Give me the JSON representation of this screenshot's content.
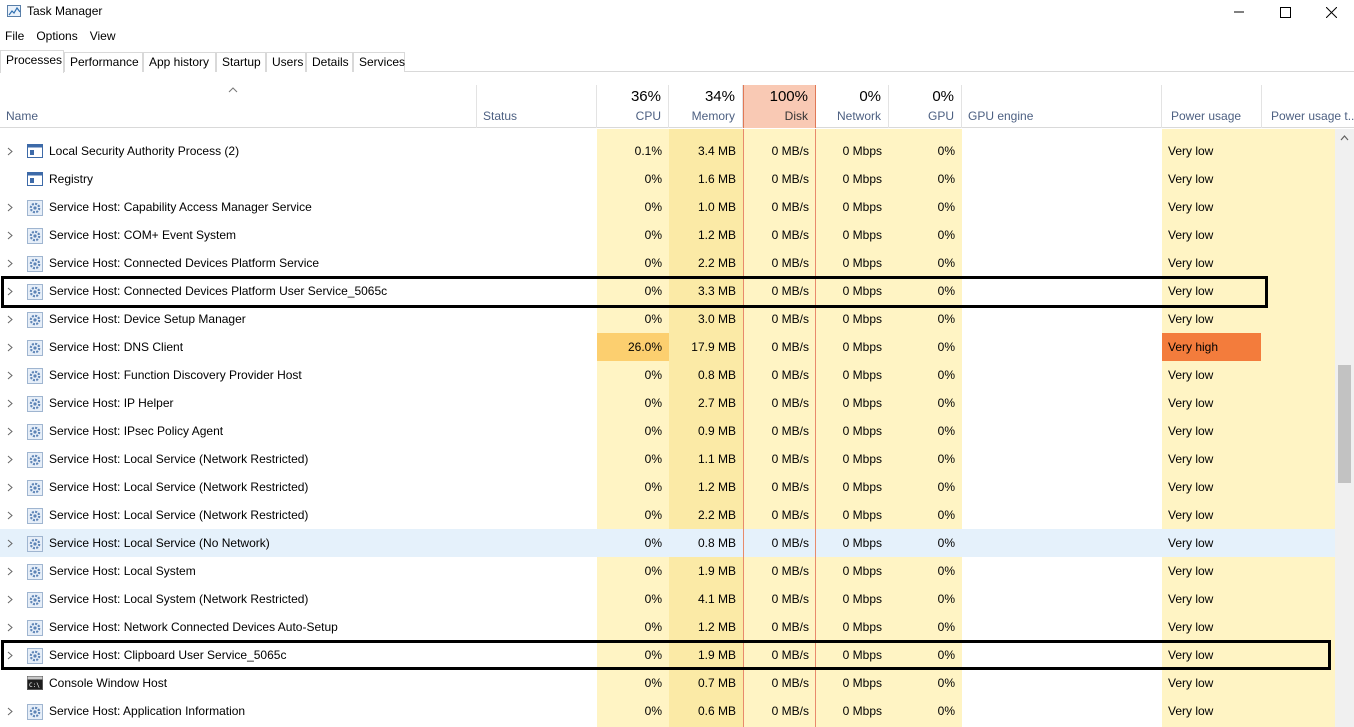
{
  "window": {
    "title": "Task Manager"
  },
  "menu": {
    "items": [
      "File",
      "Options",
      "View"
    ]
  },
  "tabs": [
    "Processes",
    "Performance",
    "App history",
    "Startup",
    "Users",
    "Details",
    "Services"
  ],
  "header": {
    "name": "Name",
    "status": "Status",
    "cpu": {
      "pct": "36%",
      "label": "CPU"
    },
    "memory": {
      "pct": "34%",
      "label": "Memory"
    },
    "disk": {
      "pct": "100%",
      "label": "Disk"
    },
    "network": {
      "pct": "0%",
      "label": "Network"
    },
    "gpu": {
      "pct": "0%",
      "label": "GPU"
    },
    "gpu_engine": "GPU engine",
    "power": "Power usage",
    "power_trend": "Power usage t..."
  },
  "rows": [
    {
      "name": "Local Security Authority Process (2)",
      "icon": "window-icon",
      "expand": true,
      "cpu": "0.1%",
      "memory": "3.4 MB",
      "disk": "0 MB/s",
      "network": "0 Mbps",
      "gpu": "0%",
      "power": "Very low"
    },
    {
      "name": "Registry",
      "icon": "window-icon",
      "expand": false,
      "cpu": "0%",
      "memory": "1.6 MB",
      "disk": "0 MB/s",
      "network": "0 Mbps",
      "gpu": "0%",
      "power": "Very low"
    },
    {
      "name": "Service Host: Capability Access Manager Service",
      "icon": "gear-icon",
      "expand": true,
      "cpu": "0%",
      "memory": "1.0 MB",
      "disk": "0 MB/s",
      "network": "0 Mbps",
      "gpu": "0%",
      "power": "Very low"
    },
    {
      "name": "Service Host: COM+ Event System",
      "icon": "gear-icon",
      "expand": true,
      "cpu": "0%",
      "memory": "1.2 MB",
      "disk": "0 MB/s",
      "network": "0 Mbps",
      "gpu": "0%",
      "power": "Very low"
    },
    {
      "name": "Service Host: Connected Devices Platform Service",
      "icon": "gear-icon",
      "expand": true,
      "cpu": "0%",
      "memory": "2.2 MB",
      "disk": "0 MB/s",
      "network": "0 Mbps",
      "gpu": "0%",
      "power": "Very low"
    },
    {
      "name": "Service Host: Connected Devices Platform User Service_5065c",
      "icon": "gear-icon",
      "expand": true,
      "cpu": "0%",
      "memory": "3.3 MB",
      "disk": "0 MB/s",
      "network": "0 Mbps",
      "gpu": "0%",
      "power": "Very low"
    },
    {
      "name": "Service Host: Device Setup Manager",
      "icon": "gear-icon",
      "expand": true,
      "cpu": "0%",
      "memory": "3.0 MB",
      "disk": "0 MB/s",
      "network": "0 Mbps",
      "gpu": "0%",
      "power": "Very low"
    },
    {
      "name": "Service Host: DNS Client",
      "icon": "gear-icon",
      "expand": true,
      "cpu": "26.0%",
      "memory": "17.9 MB",
      "disk": "0 MB/s",
      "network": "0 Mbps",
      "gpu": "0%",
      "power": "Very high",
      "hot": true
    },
    {
      "name": "Service Host: Function Discovery Provider Host",
      "icon": "gear-icon",
      "expand": true,
      "cpu": "0%",
      "memory": "0.8 MB",
      "disk": "0 MB/s",
      "network": "0 Mbps",
      "gpu": "0%",
      "power": "Very low"
    },
    {
      "name": "Service Host: IP Helper",
      "icon": "gear-icon",
      "expand": true,
      "cpu": "0%",
      "memory": "2.7 MB",
      "disk": "0 MB/s",
      "network": "0 Mbps",
      "gpu": "0%",
      "power": "Very low"
    },
    {
      "name": "Service Host: IPsec Policy Agent",
      "icon": "gear-icon",
      "expand": true,
      "cpu": "0%",
      "memory": "0.9 MB",
      "disk": "0 MB/s",
      "network": "0 Mbps",
      "gpu": "0%",
      "power": "Very low"
    },
    {
      "name": "Service Host: Local Service (Network Restricted)",
      "icon": "gear-icon",
      "expand": true,
      "cpu": "0%",
      "memory": "1.1 MB",
      "disk": "0 MB/s",
      "network": "0 Mbps",
      "gpu": "0%",
      "power": "Very low"
    },
    {
      "name": "Service Host: Local Service (Network Restricted)",
      "icon": "gear-icon",
      "expand": true,
      "cpu": "0%",
      "memory": "1.2 MB",
      "disk": "0 MB/s",
      "network": "0 Mbps",
      "gpu": "0%",
      "power": "Very low"
    },
    {
      "name": "Service Host: Local Service (Network Restricted)",
      "icon": "gear-icon",
      "expand": true,
      "cpu": "0%",
      "memory": "2.2 MB",
      "disk": "0 MB/s",
      "network": "0 Mbps",
      "gpu": "0%",
      "power": "Very low"
    },
    {
      "name": "Service Host: Local Service (No Network)",
      "icon": "gear-icon",
      "expand": true,
      "cpu": "0%",
      "memory": "0.8 MB",
      "disk": "0 MB/s",
      "network": "0 Mbps",
      "gpu": "0%",
      "power": "Very low",
      "hover": true
    },
    {
      "name": "Service Host: Local System",
      "icon": "gear-icon",
      "expand": true,
      "cpu": "0%",
      "memory": "1.9 MB",
      "disk": "0 MB/s",
      "network": "0 Mbps",
      "gpu": "0%",
      "power": "Very low"
    },
    {
      "name": "Service Host: Local System (Network Restricted)",
      "icon": "gear-icon",
      "expand": true,
      "cpu": "0%",
      "memory": "4.1 MB",
      "disk": "0 MB/s",
      "network": "0 Mbps",
      "gpu": "0%",
      "power": "Very low"
    },
    {
      "name": "Service Host: Network Connected Devices Auto-Setup",
      "icon": "gear-icon",
      "expand": true,
      "cpu": "0%",
      "memory": "1.2 MB",
      "disk": "0 MB/s",
      "network": "0 Mbps",
      "gpu": "0%",
      "power": "Very low"
    },
    {
      "name": "Service Host: Clipboard User Service_5065c",
      "icon": "gear-icon",
      "expand": true,
      "cpu": "0%",
      "memory": "1.9 MB",
      "disk": "0 MB/s",
      "network": "0 Mbps",
      "gpu": "0%",
      "power": "Very low"
    },
    {
      "name": "Console Window Host",
      "icon": "console-icon",
      "expand": false,
      "cpu": "0%",
      "memory": "0.7 MB",
      "disk": "0 MB/s",
      "network": "0 Mbps",
      "gpu": "0%",
      "power": "Very low"
    },
    {
      "name": "Service Host: Application Information",
      "icon": "gear-icon",
      "expand": true,
      "cpu": "0%",
      "memory": "0.6 MB",
      "disk": "0 MB/s",
      "network": "0 Mbps",
      "gpu": "0%",
      "power": "Very low"
    }
  ],
  "colors": {
    "cpu_bg": "#fff4c4",
    "memory_bg": "#fbeaa6",
    "disk_bg": "#fff4c4",
    "power_bg": "#fff4c4",
    "hot_cpu": "#fccf6f",
    "very_high": "#f37c3c"
  }
}
